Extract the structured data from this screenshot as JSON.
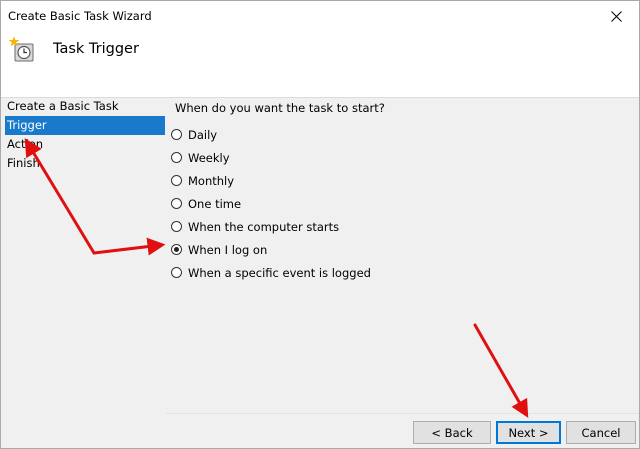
{
  "window": {
    "title": "Create Basic Task Wizard"
  },
  "header": {
    "title": "Task Trigger"
  },
  "steps": [
    {
      "label": "Create a Basic Task",
      "active": false
    },
    {
      "label": "Trigger",
      "active": true
    },
    {
      "label": "Action",
      "active": false
    },
    {
      "label": "Finish",
      "active": false
    }
  ],
  "question": "When do you want the task to start?",
  "options": [
    {
      "label": "Daily",
      "checked": false
    },
    {
      "label": "Weekly",
      "checked": false
    },
    {
      "label": "Monthly",
      "checked": false
    },
    {
      "label": "One time",
      "checked": false
    },
    {
      "label": "When the computer starts",
      "checked": false
    },
    {
      "label": "When I log on",
      "checked": true
    },
    {
      "label": "When a specific event is logged",
      "checked": false
    }
  ],
  "buttons": {
    "back": "< Back",
    "next": "Next >",
    "cancel": "Cancel"
  },
  "colors": {
    "active_step": "#1979ca",
    "annotation_arrow": "#e01010",
    "default_button_border": "#0078d7"
  },
  "icons": {
    "close": "close-icon",
    "header": "task-scheduler-clock-icon"
  }
}
